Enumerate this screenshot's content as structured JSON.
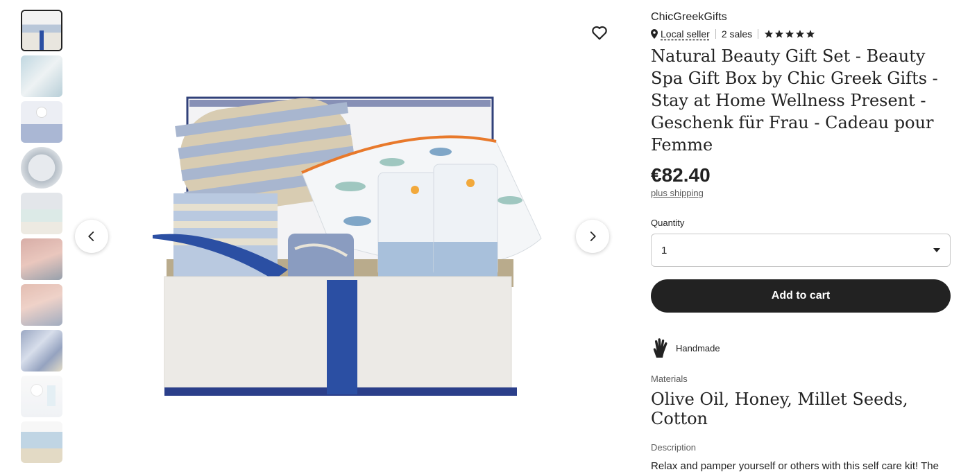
{
  "gallery": {
    "thumbnail_count": 10,
    "prev_label": "Previous image",
    "next_label": "Next image",
    "favorite_label": "Add to favorites"
  },
  "shop": {
    "name": "ChicGreekGifts",
    "local_seller": "Local seller",
    "sales": "2 sales",
    "rating_stars": 5
  },
  "listing": {
    "title": "Natural Beauty Gift Set - Beauty Spa Gift Box by Chic Greek Gifts - Stay at Home Wellness Present - Geschenk für Frau - Cadeau pour Femme",
    "price": "€82.40",
    "shipping": "plus shipping"
  },
  "quantity": {
    "label": "Quantity",
    "selected": "1"
  },
  "actions": {
    "add_to_cart": "Add to cart"
  },
  "highlights": {
    "handmade": "Handmade"
  },
  "materials": {
    "label": "Materials",
    "value": "Olive Oil, Honey, Millet Seeds, Cotton"
  },
  "description": {
    "label": "Description",
    "text": "Relax and pamper yourself or others with this self care kit! The Natural Beauty gift is a bath and body wellness"
  },
  "colors": {
    "primary": "#222222",
    "muted": "#595959",
    "accent_blue": "#2b4fa3"
  }
}
